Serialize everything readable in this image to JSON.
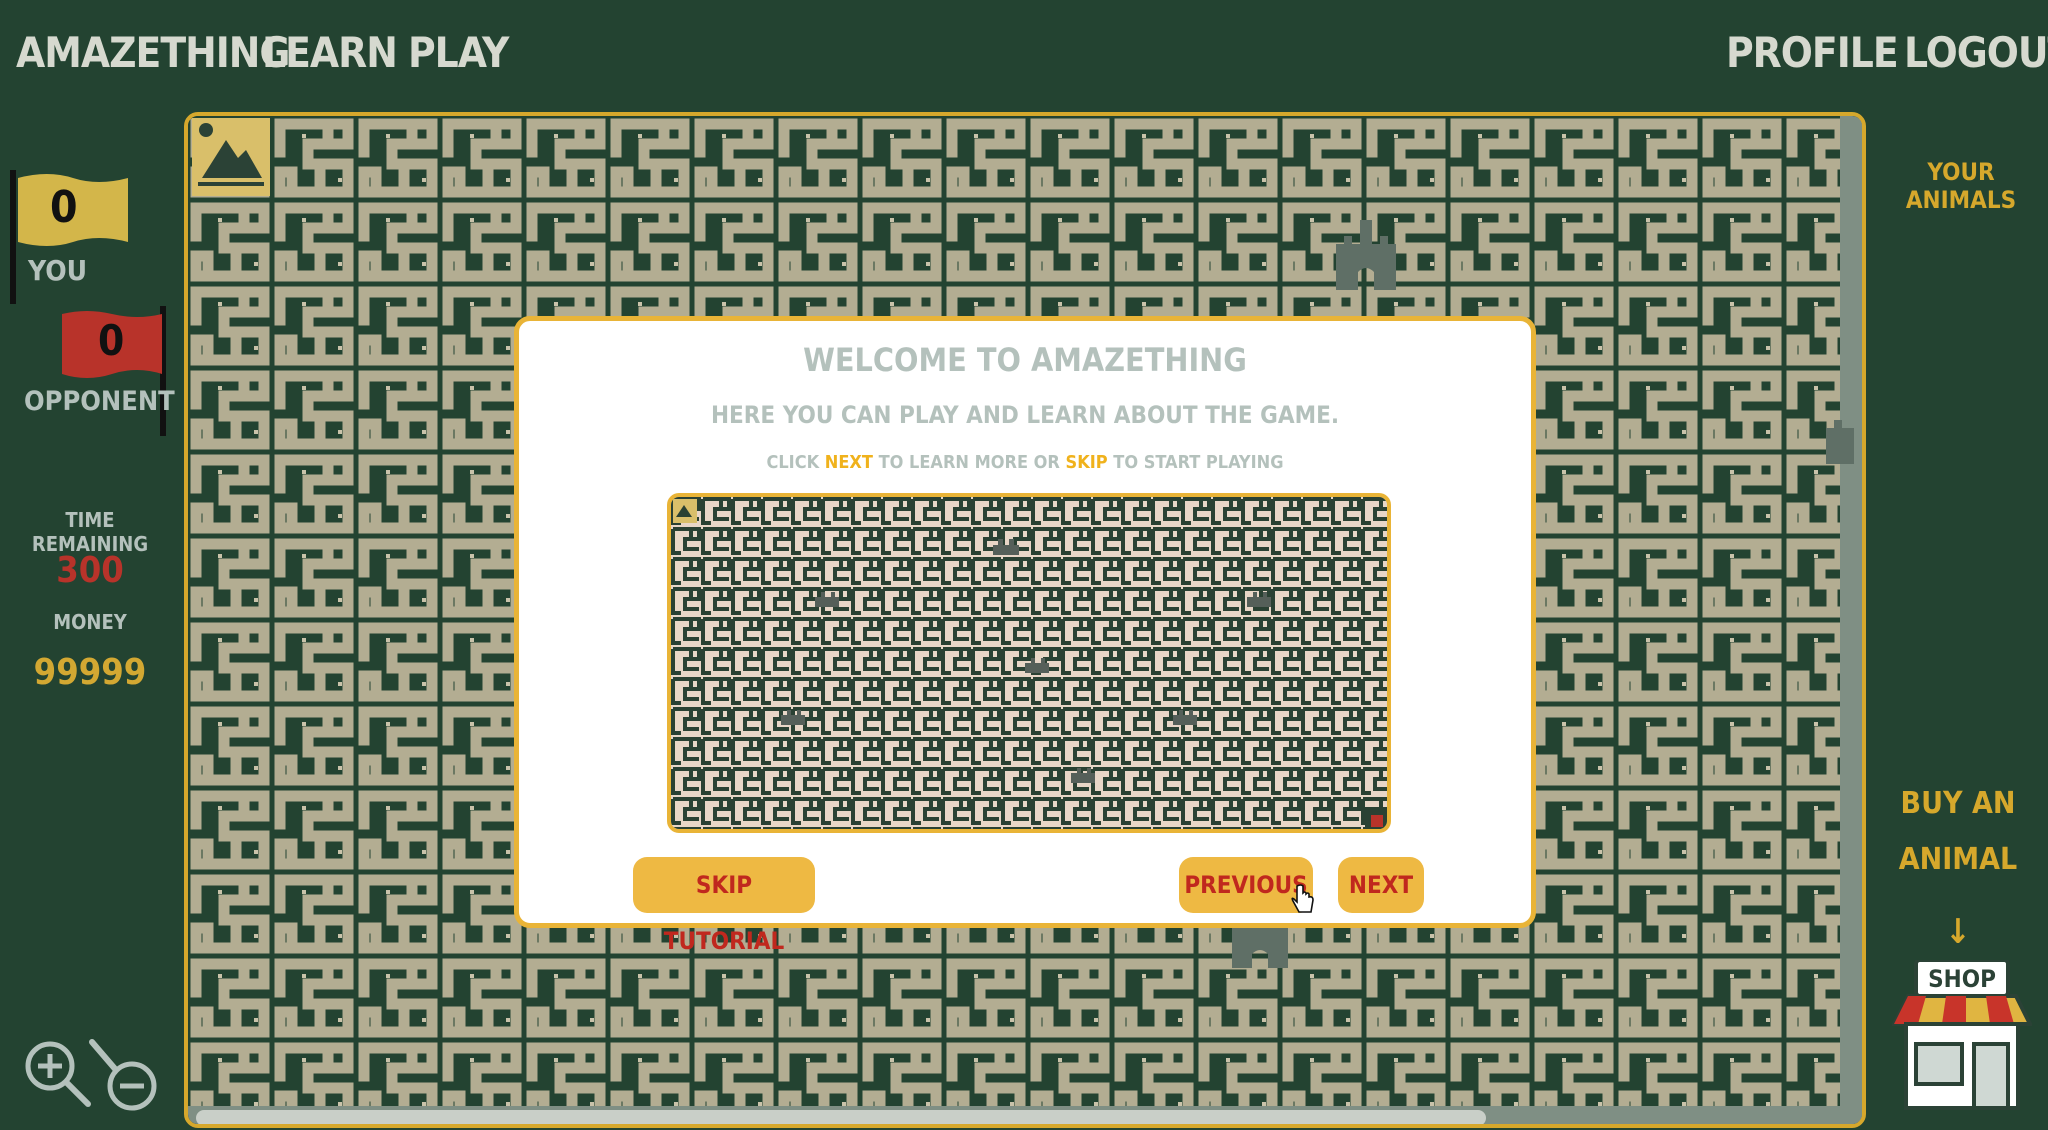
{
  "nav": {
    "brand": "AMAZETHING",
    "learn": "LEARN",
    "play": "PLAY",
    "profile": "PROFILE",
    "logout": "LOGOUT"
  },
  "scores": {
    "you_value": "0",
    "you_label": "YOU",
    "opponent_value": "0",
    "opponent_label": "OPPONENT"
  },
  "stats": {
    "time_label": "TIME REMAINING",
    "time_value": "300",
    "money_label": "MONEY",
    "money_value": "99999"
  },
  "right_panel": {
    "your_animals": "YOUR ANIMALS",
    "buy_line1": "BUY AN",
    "buy_line2": "ANIMAL",
    "arrow": "↓",
    "shop_sign": "SHOP"
  },
  "modal": {
    "title": "WELCOME TO AMAZETHING",
    "subtitle": "HERE YOU CAN PLAY AND LEARN ABOUT THE GAME.",
    "hint_click": "CLICK",
    "hint_next": "NEXT",
    "hint_middle": "TO LEARN MORE OR",
    "hint_skip": "SKIP",
    "hint_end": "TO START PLAYING",
    "skip_button": "SKIP TUTORIAL",
    "previous_button": "PREVIOUS",
    "next_button": "NEXT"
  },
  "colors": {
    "background": "#234331",
    "maze_path": "#b3ad92",
    "accent": "#e9b437",
    "red": "#c0281e",
    "muted": "#b4c1bc"
  }
}
